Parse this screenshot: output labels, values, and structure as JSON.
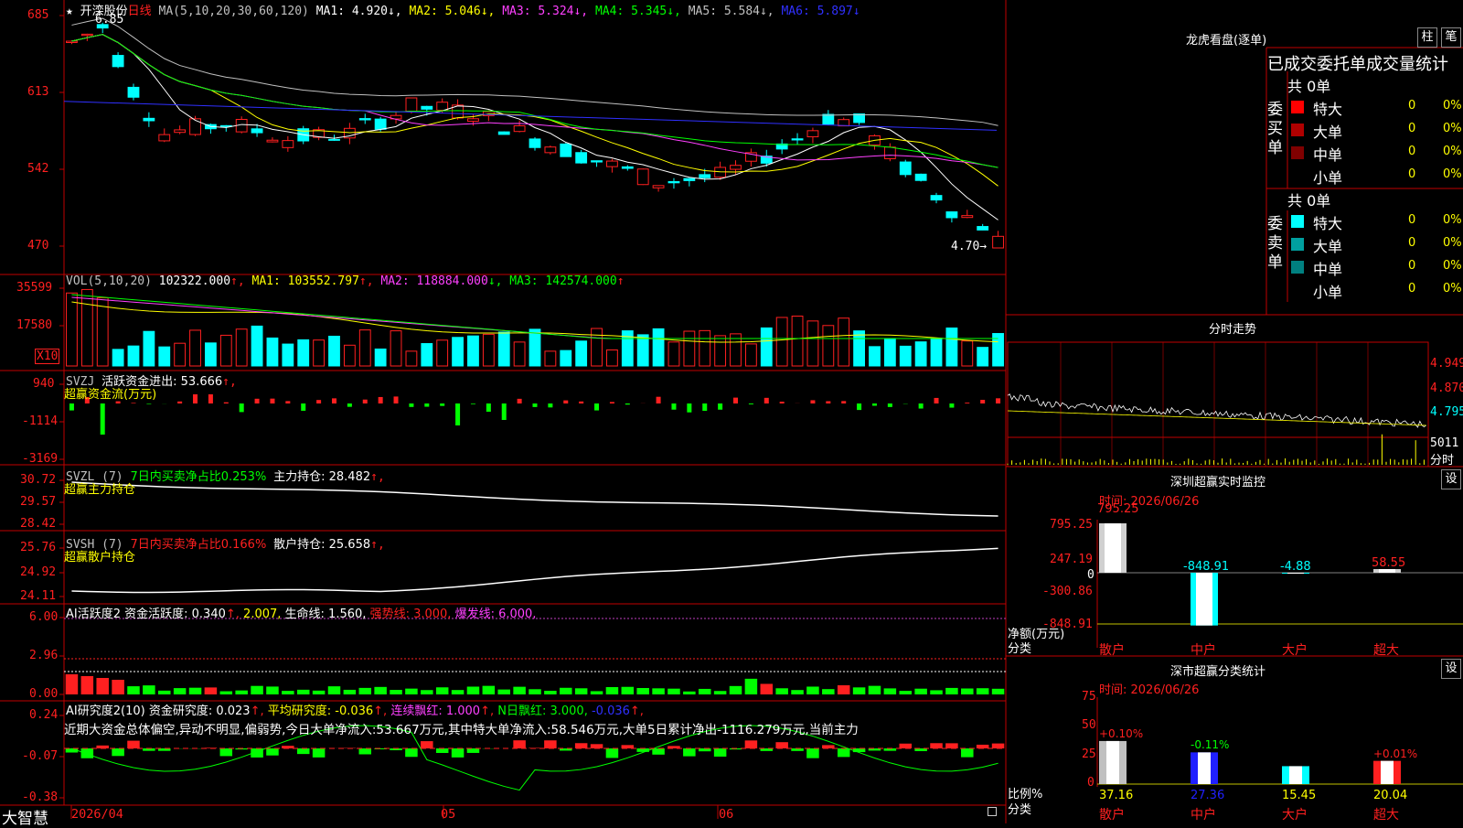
{
  "app_brand": "大智慧",
  "colors": {
    "up": "#ff2020",
    "down": "#00ffff",
    "grid": "#c00000",
    "white": "#ffffff",
    "yellow": "#ffff00",
    "magenta": "#ff40ff",
    "green": "#00ff00",
    "blue": "#3030ff",
    "gray": "#c0c0c0",
    "purple": "#c040c0"
  },
  "price_panel": {
    "star": "★",
    "stock_name": "开滦股份",
    "period": "日线",
    "ma_header": "MA(5,10,20,30,60,120)",
    "ma1": "MA1: 4.920↓,",
    "ma2": "MA2: 5.046↓,",
    "ma3": "MA3: 5.324↓,",
    "ma4": "MA4: 5.345↓,",
    "ma5": "MA5: 5.584↓,",
    "ma6": "MA6: 5.897↓",
    "high_label": "6.85",
    "low_label": "4.70→",
    "y_ticks": [
      "685",
      "613",
      "542",
      "470"
    ]
  },
  "vol_panel": {
    "header": "VOL(5,10,20)",
    "value": "102322.000",
    "ma1": "MA1: 103552.797",
    "ma2": "MA2: 118884.000",
    "ma3": "MA3: 142574.000",
    "arrows": [
      "↑,",
      "↑,",
      "↓,",
      "↑"
    ],
    "y_ticks": [
      "35599",
      "17580"
    ],
    "unit": "X10"
  },
  "svzj_panel": {
    "header": "SVZJ",
    "line1": "活跃资金进出: 53.666",
    "arrow": "↑,",
    "line2": "超赢资金流(万元)",
    "y_ticks": [
      "940",
      "-1114",
      "-3169"
    ]
  },
  "svzl_panel": {
    "header": "SVZL (7)",
    "text1": "7日内买卖净占比0.253%",
    "text2": "主力持仓: 28.482",
    "arrow": "↑,",
    "line2": "超赢主力持仓",
    "y_ticks": [
      "30.72",
      "29.57",
      "28.42"
    ]
  },
  "svsh_panel": {
    "header": "SVSH (7)",
    "text1": "7日内买卖净占比0.166%",
    "text2": "散户持仓: 25.658",
    "arrow": "↑,",
    "line2": "超赢散户持仓",
    "y_ticks": [
      "25.76",
      "24.92",
      "24.11"
    ]
  },
  "ai_active_panel": {
    "header": "AI活跃度2",
    "p1": "资金活跃度: 0.340",
    "a1": "↑,",
    "p2": "2.007,",
    "p3": "生命线: 1.560,",
    "p4": "强势线: 3.000,",
    "p5": "爆发线: 6.000,",
    "y_ticks": [
      "6.00",
      "2.96",
      "0.00"
    ]
  },
  "ai_research_panel": {
    "header": "AI研究度2(10)",
    "p1": "资金研究度: 0.023",
    "a1": "↑,",
    "p2": "平均研究度: -0.036",
    "a2": "↑,",
    "p3": "连续飘红: 1.000",
    "a3": "↑,",
    "p4": "N日飘红: 3.000,",
    "p5": "-0.036",
    "a5": "↑,",
    "summary": "近期大资金总体偏空,异动不明显,偏弱势,今日大单净流入:53.667万元,其中特大单净流入:58.546万元,大单5日累计净出-1116.279万元,当前主力",
    "y_ticks": [
      "0.24",
      "-0.07",
      "-0.38"
    ]
  },
  "x_axis": {
    "labels": [
      "2026/04",
      "05",
      "06"
    ]
  },
  "dragon_tiger": {
    "title": "龙虎看盘(逐单)",
    "btn1": "柱",
    "btn2": "笔",
    "subtitle": "已成交委托单成交量统计",
    "buy_label": "委买单",
    "sell_label": "委卖单",
    "buy_total": "共 0单",
    "sell_total": "共 0单",
    "buy_rows": [
      {
        "name": "特大",
        "count": "0",
        "pct": "0%",
        "color": "#ff0000"
      },
      {
        "name": "大单",
        "count": "0",
        "pct": "0%",
        "color": "#b00000"
      },
      {
        "name": "中单",
        "count": "0",
        "pct": "0%",
        "color": "#800000"
      },
      {
        "name": "小单",
        "count": "0",
        "pct": "0%",
        "color": "#000000"
      }
    ],
    "sell_rows": [
      {
        "name": "特大",
        "count": "0",
        "pct": "0%",
        "color": "#00ffff"
      },
      {
        "name": "大单",
        "count": "0",
        "pct": "0%",
        "color": "#00a0a0"
      },
      {
        "name": "中单",
        "count": "0",
        "pct": "0%",
        "color": "#008080"
      },
      {
        "name": "小单",
        "count": "0",
        "pct": "0%",
        "color": "#000000"
      }
    ]
  },
  "intraday": {
    "title": "分时走势",
    "y_ticks": [
      "4.949",
      "4.870",
      "4.795"
    ],
    "vol_label": "5011",
    "vol_unit": "分时"
  },
  "sz_monitor": {
    "title": "深圳超赢实时监控",
    "settings": "设",
    "time": "时间: 2026/06/26",
    "y_ticks": [
      "795.25",
      "247.19",
      "0",
      "-300.86",
      "-848.91"
    ],
    "unit1": "净额(万元)",
    "unit2": "分类",
    "categories": [
      "散户",
      "中户",
      "大户",
      "超大"
    ],
    "values": [
      795.25,
      -848.91,
      -4.88,
      58.55
    ],
    "value_labels": [
      "795.25",
      "-848.91",
      "-4.88",
      "58.55"
    ]
  },
  "sz_category": {
    "title": "深市超赢分类统计",
    "settings": "设",
    "time": "时间: 2026/06/26",
    "y_ticks": [
      "75",
      "50",
      "25",
      "0"
    ],
    "unit1": "比例%",
    "unit2": "分类",
    "categories": [
      "散户",
      "中户",
      "大户",
      "超大"
    ],
    "values": [
      37.16,
      27.36,
      15.45,
      20.04
    ],
    "value_labels": [
      "37.16",
      "27.36",
      "15.45",
      "20.04"
    ],
    "change_labels": [
      "+0.10%",
      "-0.11%",
      "",
      "+0.01%"
    ]
  }
}
